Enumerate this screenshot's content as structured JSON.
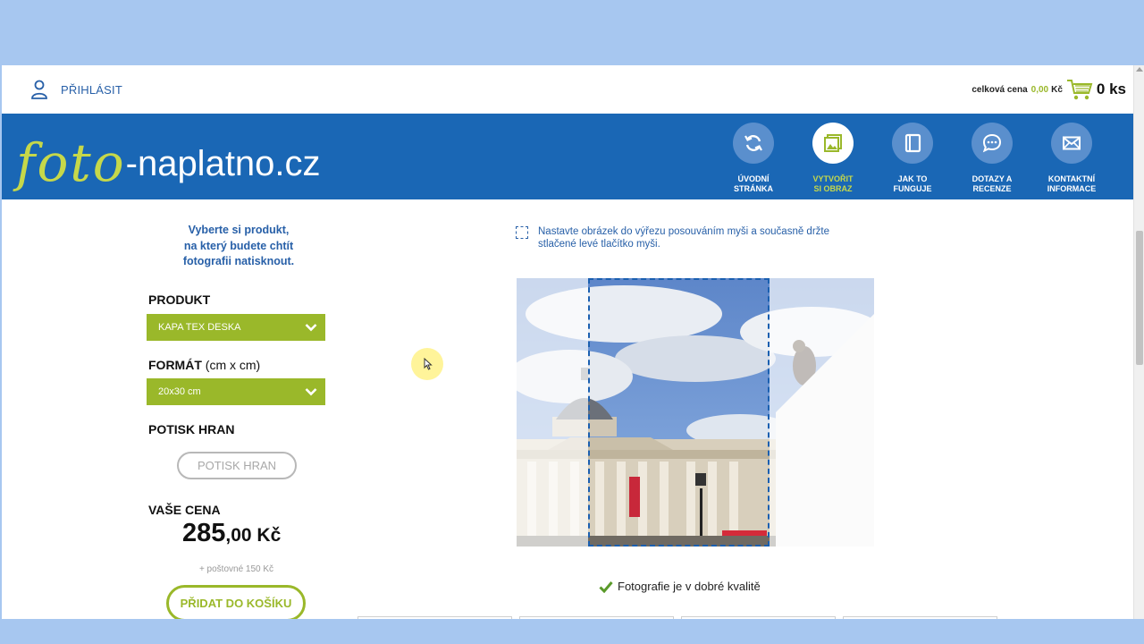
{
  "header": {
    "login_label": "PŘIHLÁSIT",
    "cart": {
      "total_label": "celková cena",
      "total_value": "0,00",
      "currency": "Kč",
      "count": "0 ks"
    },
    "logo": {
      "script_part": "foto",
      "rest_part": "-naplatno.cz"
    },
    "nav": [
      {
        "label": "ÚVODNÍ\nSTRÁNKA",
        "icon": "refresh-icon",
        "active": false
      },
      {
        "label": "VYTVOŘIT\nSI OBRAZ",
        "icon": "image-icon",
        "active": true
      },
      {
        "label": "JAK TO\nFUNGUJE",
        "icon": "book-icon",
        "active": false
      },
      {
        "label": "DOTAZY A\nRECENZE",
        "icon": "chat-icon",
        "active": false
      },
      {
        "label": "KONTAKTNÍ\nINFORMACE",
        "icon": "mail-icon",
        "active": false
      }
    ]
  },
  "sidebar": {
    "intro": "Vyberte si produkt,\nna který budete chtít\nfotografii natisknout.",
    "product_label": "PRODUKT",
    "product_value": "KAPA TEX DESKA",
    "format_label": "FORMÁT",
    "format_unit": "(cm x cm)",
    "format_value": "20x30 cm",
    "edges_label": "POTISK HRAN",
    "edges_button": "POTISK HRAN",
    "price_label": "VAŠE CENA",
    "price_main": "285",
    "price_cents": ",00 Kč",
    "shipping": "+ poštovné 150 Kč",
    "add_button": "PŘIDAT DO KOŠÍKU"
  },
  "editor": {
    "hint": "Nastavte obrázek do výřezu posouváním myši a současně držte\nstlačené levé tlačítko myši.",
    "quality": "Fotografie je v dobré kvalitě"
  },
  "colors": {
    "brand_blue": "#1a67b5",
    "accent_green": "#9ab82a",
    "logo_green": "#c6d84a"
  }
}
